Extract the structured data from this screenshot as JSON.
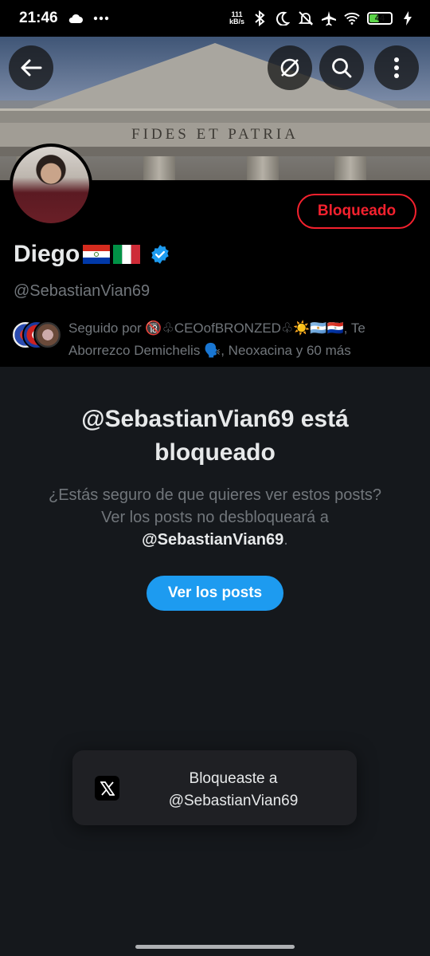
{
  "status_bar": {
    "time": "21:46",
    "net_speed_value": "111",
    "net_speed_unit": "kB/s",
    "battery": "44",
    "icons": [
      "cloud-icon",
      "more-dots-icon",
      "bluetooth-icon",
      "moon-icon",
      "mute-icon",
      "airplane-icon",
      "wifi-icon",
      "battery-icon",
      "charging-icon"
    ]
  },
  "banner": {
    "inscription": "FIDES ET PATRIA"
  },
  "header_buttons": {
    "back": "back-arrow-icon",
    "grok": "grok-icon",
    "search": "search-icon",
    "more": "more-vertical-icon"
  },
  "profile": {
    "display_name": "Diego",
    "flags": [
      "paraguay-flag",
      "italy-flag"
    ],
    "verified": true,
    "handle": "@SebastianVian69",
    "blocked_label": "Bloqueado",
    "followed_by": "Seguido por 🔞♧CEOofBRONZED♧☀️🇦🇷🇵🇾, Te Aborrezco Demichelis 🗣️, Neoxacina y 60 más"
  },
  "blocked_notice": {
    "title": "@SebastianVian69 está bloqueado",
    "description_prefix": "¿Estás seguro de que quieres ver estos posts? Ver los posts no desbloqueará a",
    "description_handle": "@SebastianVian69",
    "description_suffix": ".",
    "view_posts_label": "Ver los posts"
  },
  "toast": {
    "line1": "Bloqueaste a",
    "line2": "@SebastianVian69",
    "icon": "x-logo-icon"
  },
  "colors": {
    "accent": "#1d9bf0",
    "danger": "#f4212e",
    "background": "#15181c",
    "secondary_text": "#71767b"
  }
}
